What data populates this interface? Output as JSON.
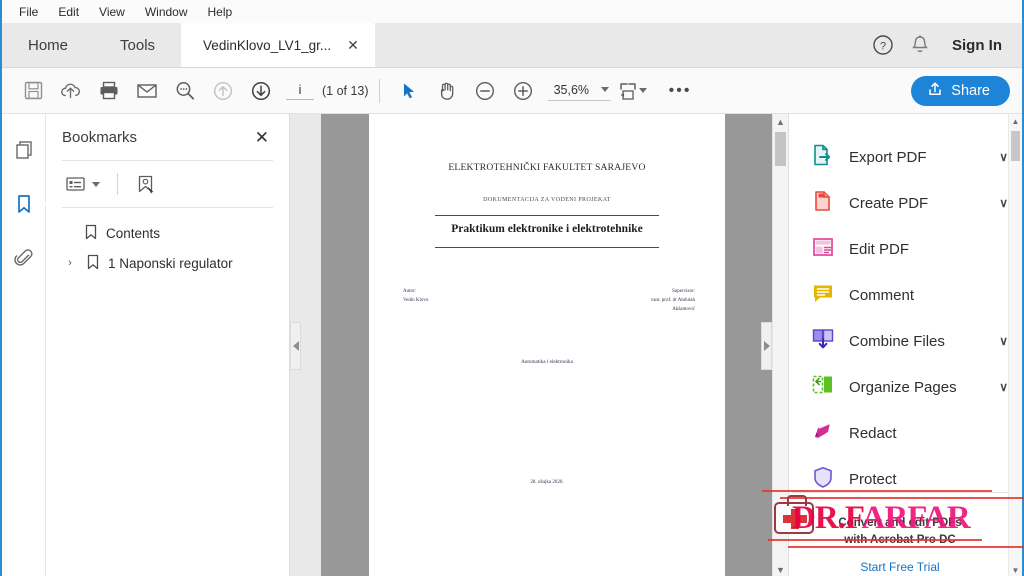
{
  "window": {
    "menus": [
      "File",
      "Edit",
      "View",
      "Window",
      "Help"
    ]
  },
  "tabs": {
    "home": "Home",
    "tools": "Tools",
    "document": "VedinKlovo_LV1_gr...",
    "close_label": "✕",
    "signin": "Sign In"
  },
  "toolbar": {
    "page_value": "i",
    "page_count": "(1 of 13)",
    "zoom_value": "35,6%",
    "more_label": "•••",
    "share_label": "Share"
  },
  "bookmarks": {
    "title": "Bookmarks",
    "close_label": "✕",
    "items": [
      {
        "label": "Contents",
        "expandable": false
      },
      {
        "label": "1 Naponski regulator",
        "expandable": true,
        "twisty": "›"
      }
    ]
  },
  "tools_panel": {
    "items": [
      {
        "label": "Export PDF",
        "icon": "export-pdf-icon",
        "chevron": "∨"
      },
      {
        "label": "Create PDF",
        "icon": "create-pdf-icon",
        "chevron": "∨"
      },
      {
        "label": "Edit PDF",
        "icon": "edit-pdf-icon",
        "chevron": ""
      },
      {
        "label": "Comment",
        "icon": "comment-icon",
        "chevron": ""
      },
      {
        "label": "Combine Files",
        "icon": "combine-files-icon",
        "chevron": "∨"
      },
      {
        "label": "Organize Pages",
        "icon": "organize-pages-icon",
        "chevron": "∨"
      },
      {
        "label": "Redact",
        "icon": "redact-icon",
        "chevron": ""
      },
      {
        "label": "Protect",
        "icon": "protect-icon",
        "chevron": ""
      }
    ]
  },
  "promo": {
    "line1": "Convert and edit PDFs",
    "line2": "with Acrobat Pro DC",
    "cta": "Start Free Trial"
  },
  "watermark": {
    "text_left": "DR.F",
    "text_right": "ARFAR"
  },
  "document": {
    "faculty": "ELEKTROTEHNIČKI FAKULTET SARAJEVO",
    "subtitle": "DOKUMENTACIJA ZA VODENI PROJEKAT",
    "title": "Praktikum elektronike i elektrotehnike",
    "author_label": "Autor:",
    "author_name": "Vedin Klovo",
    "supervisor_label": "Supervisor:",
    "supervisor_name": "vanr. prof. dr Abdulah",
    "supervisor_name2": "Akšamović",
    "department": "Automatika i elektronika",
    "date": "28. ožujka 2020."
  },
  "colors": {
    "accent_blue": "#1d84d8",
    "window_border": "#2e8bd0",
    "bookmark_active": "#1473c6",
    "watermark_pink": "#f0147a",
    "watermark_red": "#e8332a"
  }
}
